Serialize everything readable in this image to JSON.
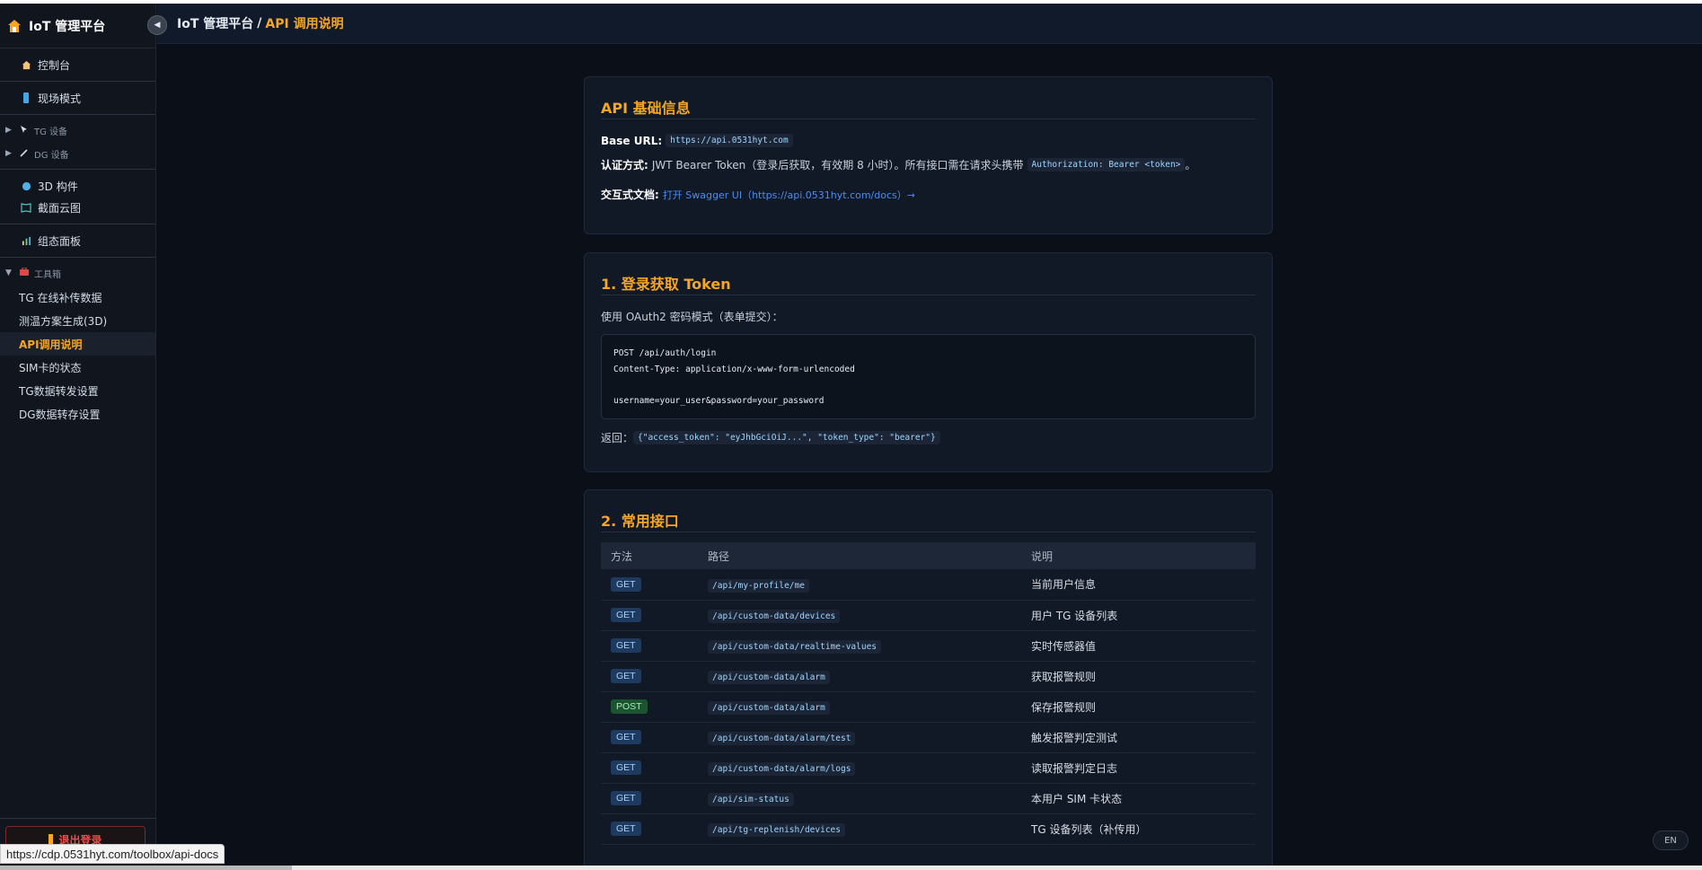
{
  "brand": {
    "title": "IoT 管理平台"
  },
  "sidebar": {
    "items_top": [
      {
        "label": "控制台",
        "icon": "home-icon"
      },
      {
        "label": "现场模式",
        "icon": "phone-icon"
      }
    ],
    "groups": [
      {
        "label": "TG 设备",
        "icon": "pointer-icon"
      },
      {
        "label": "DG 设备",
        "icon": "pen-icon"
      }
    ],
    "items_mid": [
      {
        "label": "3D 构件",
        "icon": "globe-icon"
      },
      {
        "label": "截面云图",
        "icon": "book-icon"
      },
      {
        "label": "组态面板",
        "icon": "chart-icon"
      }
    ],
    "toolbox": {
      "label": "工具箱",
      "icon": "toolbox-icon",
      "items": [
        "TG 在线补传数据",
        "测温方案生成(3D)",
        "API调用说明",
        "SIM卡的状态",
        "TG数据转发设置",
        "DG数据转存设置"
      ],
      "active": "API调用说明"
    },
    "logout": "退出登录"
  },
  "header": {
    "root": "IoT 管理平台",
    "separator": "/",
    "current": "API 调用说明"
  },
  "card_basic": {
    "title": "API 基础信息",
    "base_url_label": "Base URL:",
    "base_url": "https://api.0531hyt.com",
    "auth_label": "认证方式:",
    "auth_text": "JWT Bearer Token（登录后获取，有效期 8 小时）。所有接口需在请求头携带",
    "auth_header": "Authorization: Bearer <token>",
    "auth_end": "。",
    "docs_label": "交互式文档:",
    "docs_link": "打开 Swagger UI（https://api.0531hyt.com/docs）→"
  },
  "card_login": {
    "title": "1. 登录获取 Token",
    "intro": "使用 OAuth2 密码模式（表单提交）：",
    "code_lines": [
      "POST /api/auth/login",
      "Content-Type: application/x-www-form-urlencoded",
      "",
      "username=your_user&password=your_password"
    ],
    "return_label": "返回：",
    "return_value": "{\"access_token\": \"eyJhbGciOiJ...\", \"token_type\": \"bearer\"}"
  },
  "card_endpoints": {
    "title": "2. 常用接口",
    "columns": [
      "方法",
      "路径",
      "说明"
    ],
    "rows": [
      {
        "method": "GET",
        "path": "/api/my-profile/me",
        "desc": "当前用户信息"
      },
      {
        "method": "GET",
        "path": "/api/custom-data/devices",
        "desc": "用户 TG 设备列表"
      },
      {
        "method": "GET",
        "path": "/api/custom-data/realtime-values",
        "desc": "实时传感器值"
      },
      {
        "method": "GET",
        "path": "/api/custom-data/alarm",
        "desc": "获取报警规则"
      },
      {
        "method": "POST",
        "path": "/api/custom-data/alarm",
        "desc": "保存报警规则"
      },
      {
        "method": "GET",
        "path": "/api/custom-data/alarm/test",
        "desc": "触发报警判定测试"
      },
      {
        "method": "GET",
        "path": "/api/custom-data/alarm/logs",
        "desc": "读取报警判定日志"
      },
      {
        "method": "GET",
        "path": "/api/sim-status",
        "desc": "本用户 SIM 卡状态"
      },
      {
        "method": "GET",
        "path": "/api/tg-replenish/devices",
        "desc": "TG 设备列表（补传用）"
      }
    ]
  },
  "lang_button": "EN",
  "status_bar_url": "https://cdp.0531hyt.com/toolbox/api-docs",
  "colors": {
    "accent": "#f5a623",
    "link": "#4b8df0",
    "background": "#0b0f17",
    "get_badge": "#1e3a5f",
    "post_badge": "#1c5330"
  }
}
